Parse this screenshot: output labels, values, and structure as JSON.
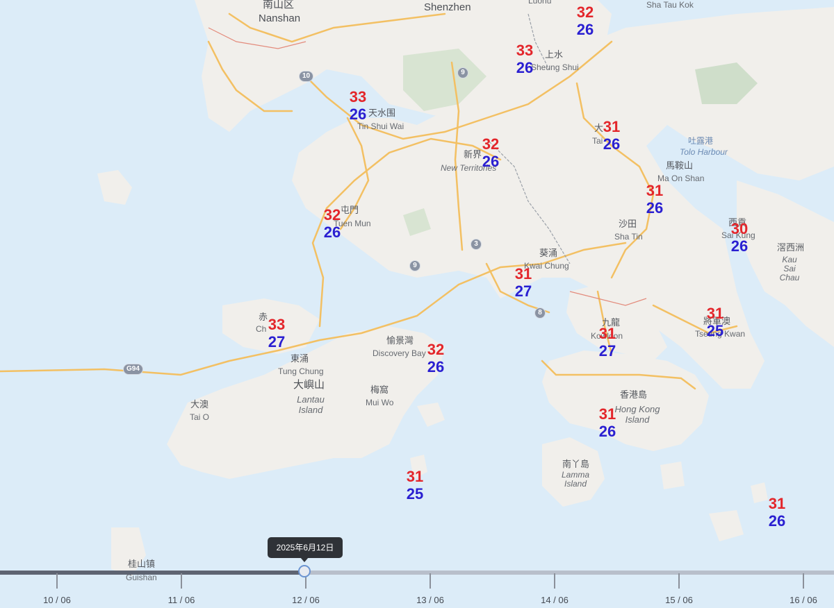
{
  "map": {
    "places": {
      "nanshan_cn": "南山区",
      "nanshan": "Nanshan",
      "shenzhen": "Shenzhen",
      "luohu": "Luohu",
      "shataukok": "Sha Tau Kok",
      "sheungshui_cn": "上水",
      "sheungshui": "Sheung Shui",
      "tinshuiwai_cn": "天水围",
      "tinshuiwai": "Tin Shui Wai",
      "taipo_cn": "大",
      "taipo": "Tai",
      "tolo_cn": "吐露港",
      "tolo": "Tolo Harbour",
      "newterr_cn": "新界",
      "newterr": "New Territories",
      "maonshan_cn": "馬鞍山",
      "maonshan": "Ma On Shan",
      "tuenmun_cn": "屯門",
      "tuenmun": "Tuen Mun",
      "shatin_cn": "沙田",
      "shatin": "Sha Tin",
      "saikung_cn": "西貢",
      "saikung": "Sai Kung",
      "kausai_cn": "滘西洲",
      "kausai": "Kau Sai Chau",
      "kwaichung_cn": "葵涌",
      "kwaichung": "Kwai Chung",
      "chek_cn": "赤",
      "chek": "Ch",
      "kowloon_cn": "九龍",
      "kowloon": "Kowloon",
      "tseungkwan_cn": "將軍澳",
      "tseungkwan": "Tseung Kwan",
      "tungchung_cn": "東涌",
      "tungchung": "Tung Chung",
      "discovery_cn": "愉景灣",
      "discovery": "Discovery Bay",
      "lantau_cn": "大嶼山",
      "lantau": "Lantau Island",
      "muiwo_cn": "梅窩",
      "muiwo": "Mui Wo",
      "taio_cn": "大澳",
      "taio": "Tai O",
      "hkisland_cn": "香港島",
      "hkisland": "Hong Kong Island",
      "lamma_cn": "南丫島",
      "lamma": "Lamma Island",
      "guishan_cn": "桂山镇",
      "guishan": "Guishan"
    },
    "shields": [
      "10",
      "9",
      "9",
      "3",
      "8",
      "G94"
    ]
  },
  "stations": [
    {
      "max": "32",
      "min": "26"
    },
    {
      "max": "33",
      "min": "26"
    },
    {
      "max": "33",
      "min": "26"
    },
    {
      "max": "32",
      "min": "26"
    },
    {
      "max": "31",
      "min": "26"
    },
    {
      "max": "31",
      "min": "26"
    },
    {
      "max": "32",
      "min": "26"
    },
    {
      "max": "30",
      "min": "26"
    },
    {
      "max": "31",
      "min": "27"
    },
    {
      "max": "33",
      "min": "27"
    },
    {
      "max": "31",
      "min": "25"
    },
    {
      "max": "31",
      "min": "27"
    },
    {
      "max": "32",
      "min": "26"
    },
    {
      "max": "31",
      "min": "26"
    },
    {
      "max": "31",
      "min": "25"
    },
    {
      "max": "31",
      "min": "26"
    }
  ],
  "timeline": {
    "tooltip": "2025年6月12日",
    "ticks": [
      "10 / 06",
      "11 / 06",
      "12 / 06",
      "13 / 06",
      "14 / 06",
      "15 / 06",
      "16 / 06"
    ],
    "selected": "12 / 06"
  },
  "colors": {
    "water": "#dcecf8",
    "land": "#f1efeb",
    "max_temp": "#e3262b",
    "min_temp": "#2a1fd1"
  }
}
